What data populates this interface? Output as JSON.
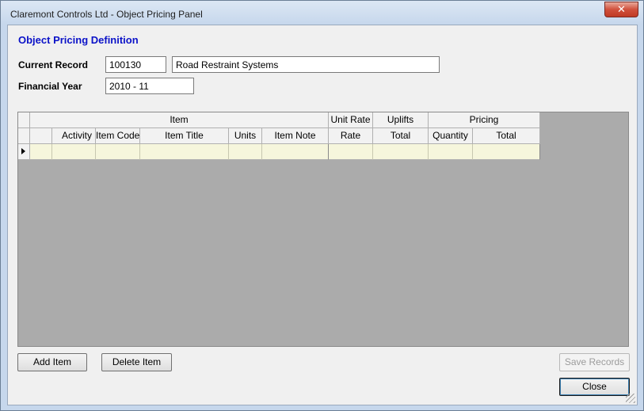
{
  "window": {
    "title": "Claremont Controls Ltd - Object Pricing Panel",
    "close_glyph": "✕"
  },
  "form": {
    "heading": "Object Pricing Definition",
    "current_record_label": "Current Record",
    "current_record_id": "100130",
    "current_record_name": "Road Restraint Systems",
    "financial_year_label": "Financial Year",
    "financial_year_value": "2010 - 11"
  },
  "grid": {
    "group_headers": {
      "item": "Item",
      "unit_rate": "Unit Rate",
      "uplifts": "Uplifts",
      "pricing": "Pricing"
    },
    "columns": {
      "activity": "Activity",
      "item_code": "Item Code",
      "item_title": "Item Title",
      "units": "Units",
      "item_note": "Item Note",
      "rate": "Rate",
      "uplift_total": "Total",
      "quantity": "Quantity",
      "pricing_total": "Total"
    }
  },
  "buttons": {
    "add_item": "Add Item",
    "delete_item": "Delete Item",
    "save_records": "Save Records",
    "close": "Close"
  }
}
